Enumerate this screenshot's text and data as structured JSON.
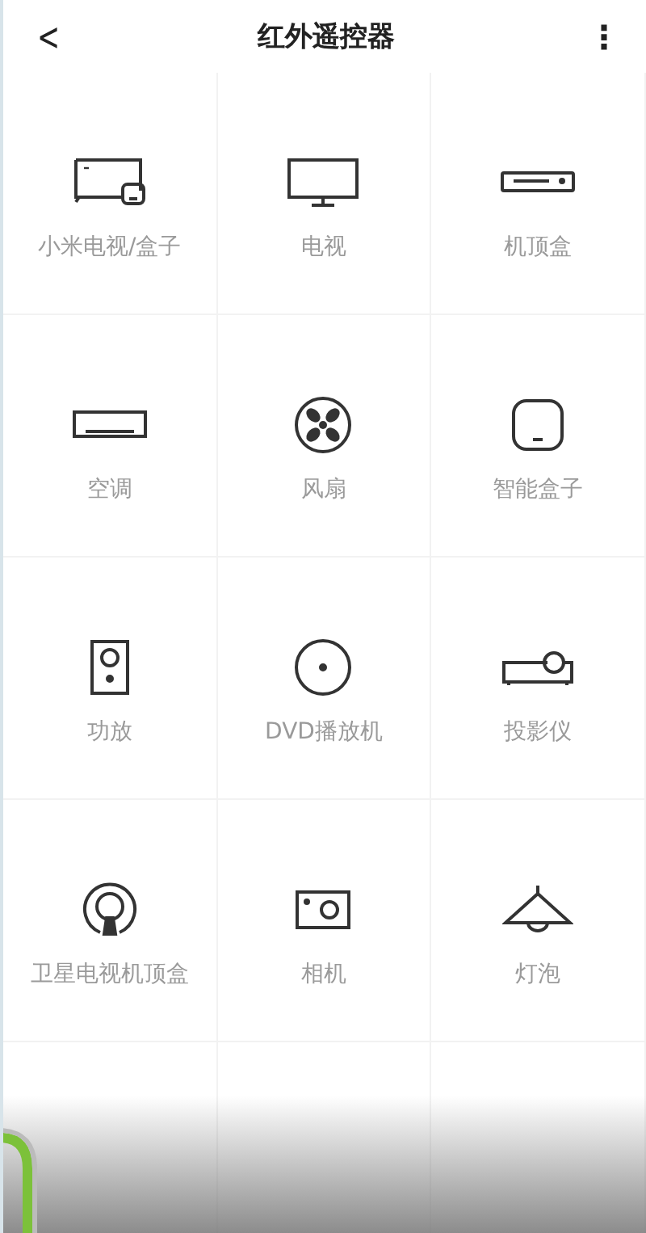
{
  "header": {
    "title": "红外遥控器",
    "back": "<",
    "menu": "⋮"
  },
  "devices": [
    {
      "label": "小米电视/盒子",
      "kind": "mitv"
    },
    {
      "label": "电视",
      "kind": "tv"
    },
    {
      "label": "机顶盒",
      "kind": "stb"
    },
    {
      "label": "空调",
      "kind": "ac"
    },
    {
      "label": "风扇",
      "kind": "fan"
    },
    {
      "label": "智能盒子",
      "kind": "box"
    },
    {
      "label": "功放",
      "kind": "speaker"
    },
    {
      "label": "DVD播放机",
      "kind": "dvd"
    },
    {
      "label": "投影仪",
      "kind": "projector"
    },
    {
      "label": "卫星电视机顶盒",
      "kind": "satellite"
    },
    {
      "label": "相机",
      "kind": "camera"
    },
    {
      "label": "灯泡",
      "kind": "lamp"
    }
  ]
}
